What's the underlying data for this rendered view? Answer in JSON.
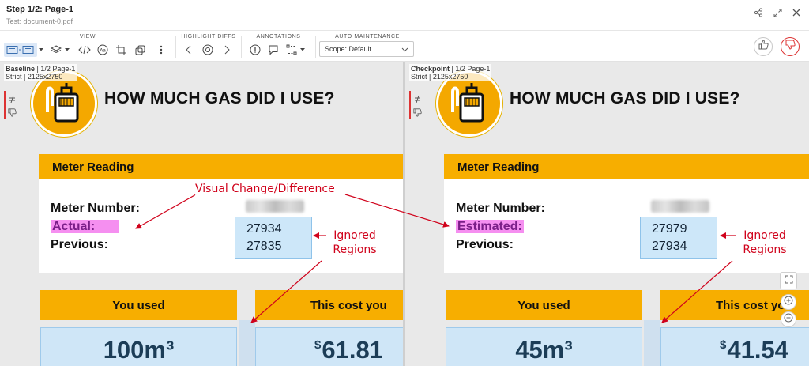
{
  "header": {
    "step_title": "Step 1/2: Page-1",
    "test_name": "Test: document-0.pdf"
  },
  "toolbar": {
    "groups": {
      "view": "VIEW",
      "highlight_diffs": "HIGHLIGHT DIFFS",
      "annotations": "ANNOTATIONS",
      "auto_maintenance": "AUTO MAINTENANCE"
    },
    "scope_value": "Scope: Default"
  },
  "panes": {
    "baseline": {
      "label": "Baseline",
      "page": "1/2 Page-1",
      "match": "Strict",
      "size": "2125x2750"
    },
    "checkpoint": {
      "label": "Checkpoint",
      "page": "1/2 Page-1",
      "match": "Strict",
      "size": "2125x2750"
    }
  },
  "document": {
    "headline": "HOW MUCH GAS DID I USE?",
    "card_title": "Meter Reading",
    "meter_number_label": "Meter Number:",
    "previous_label": "Previous:",
    "you_used_label": "You used",
    "cost_label": "This cost you",
    "currency_symbol": "$"
  },
  "baseline_doc": {
    "reading_label": "Actual:",
    "reading_value": "27934",
    "previous_value": "27835",
    "used_value": "100m³",
    "cost_value": "61.81"
  },
  "checkpoint_doc": {
    "reading_label": "Estimated:",
    "reading_value": "27979",
    "previous_value": "27934",
    "used_value": "45m³",
    "cost_value": "41.54"
  },
  "annotations": {
    "visual_change": "Visual Change/Difference",
    "ignored_regions": "Ignored\nRegions"
  },
  "colors": {
    "accent_orange": "#f7ae00",
    "diff_highlight": "#f58ff0",
    "ignored_region": "#cde7f9",
    "annotation_red": "#d0021b"
  }
}
